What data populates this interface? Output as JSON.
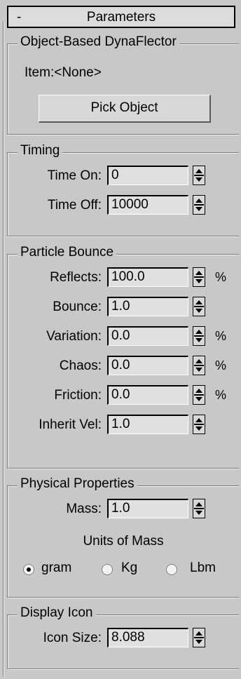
{
  "title": {
    "collapse_symbol": "-",
    "label": "Parameters"
  },
  "object_group": {
    "label": "Object-Based DynaFlector",
    "item_text": "Item:<None>",
    "pick_button": "Pick Object"
  },
  "timing": {
    "label": "Timing",
    "time_on": {
      "label": "Time On:",
      "value": "0"
    },
    "time_off": {
      "label": "Time Off:",
      "value": "10000"
    }
  },
  "bounce": {
    "label": "Particle Bounce",
    "reflects": {
      "label": "Reflects:",
      "value": "100.0",
      "unit": "%"
    },
    "bounce": {
      "label": "Bounce:",
      "value": "1.0"
    },
    "variation": {
      "label": "Variation:",
      "value": "0.0",
      "unit": "%"
    },
    "chaos": {
      "label": "Chaos:",
      "value": "0.0",
      "unit": "%"
    },
    "friction": {
      "label": "Friction:",
      "value": "0.0",
      "unit": "%"
    },
    "inherit_vel": {
      "label": "Inherit Vel:",
      "value": "1.0"
    }
  },
  "physical": {
    "label": "Physical Properties",
    "mass": {
      "label": "Mass:",
      "value": "1.0"
    },
    "units_label": "Units of Mass",
    "units": [
      {
        "label": "gram",
        "selected": true
      },
      {
        "label": "Kg",
        "selected": false
      },
      {
        "label": "Lbm",
        "selected": false
      }
    ]
  },
  "display": {
    "label": "Display Icon",
    "icon_size": {
      "label": "Icon Size:",
      "value": "8.088"
    }
  }
}
